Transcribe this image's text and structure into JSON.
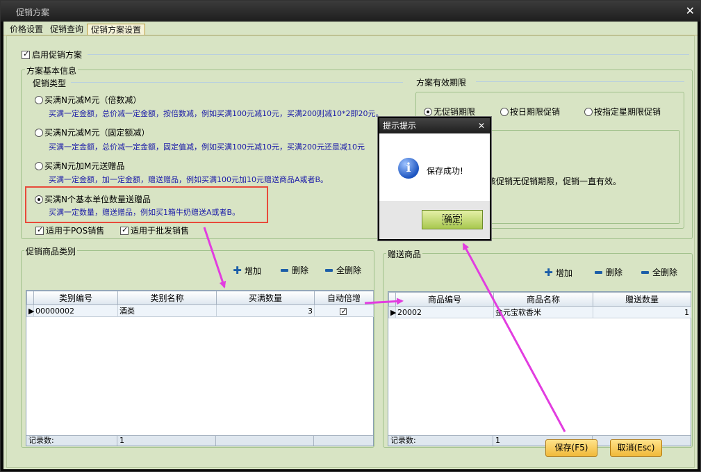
{
  "window": {
    "title": "促销方案",
    "close_glyph": "✕"
  },
  "tabs": [
    {
      "label": "价格设置"
    },
    {
      "label": "促销查询"
    },
    {
      "label": "促销方案设置"
    }
  ],
  "enable_label": "启用促销方案",
  "basic_info": {
    "title": "方案基本信息",
    "type_title": "促销类型",
    "options": [
      {
        "label": "买满N元减M元（倍数减）",
        "desc": "买满一定金额，总价减一定金额，按倍数减，例如买满100元减10元，买满200则减10*2即20元。"
      },
      {
        "label": "买满N元减M元（固定额减）",
        "desc": "买满一定金额，总价减一定金额，固定值减，例如买满100元减10元，买满200元还是减10元"
      },
      {
        "label": "买满N元加M元送赠品",
        "desc": "买满一定金额，加一定金额，赠送赠品，例如买满100元加10元赠送商品A或者B。"
      },
      {
        "label": "买满N个基本单位数量送赠品",
        "desc": "买满一定数量，赠送赠品，例如买1箱牛奶赠送A或者B。"
      }
    ],
    "pos_label": "适用于POS销售",
    "wholesale_label": "适用于批发销售"
  },
  "validity": {
    "title": "方案有效期限",
    "options": [
      {
        "label": "无促销期限"
      },
      {
        "label": "按日期限促销"
      },
      {
        "label": "按指定星期限促销"
      }
    ],
    "note": "该促销无促销期限，促销一直有效。"
  },
  "category_panel": {
    "title": "促销商品类别",
    "add_label": "增加",
    "delete_label": "删除",
    "delete_all_label": "全删除",
    "columns": [
      "类别编号",
      "类别名称",
      "买满数量",
      "自动倍增"
    ],
    "rows": [
      {
        "code": "00000002",
        "name": "酒类",
        "qty": "3",
        "auto": true
      }
    ],
    "footer_label": "记录数:",
    "footer_count": "1"
  },
  "gift_panel": {
    "title": "赠送商品",
    "add_label": "增加",
    "delete_label": "删除",
    "delete_all_label": "全删除",
    "columns": [
      "商品编号",
      "商品名称",
      "赠送数量"
    ],
    "rows": [
      {
        "code": "20002",
        "name": "金元宝软香米",
        "qty": "1"
      }
    ],
    "footer_label": "记录数:",
    "footer_count": "1"
  },
  "buttons": {
    "save": "保存(F5)",
    "cancel": "取消(Esc)"
  },
  "dialog": {
    "title": "提示提示",
    "message": "保存成功!",
    "ok": "确定",
    "close_glyph": "✕",
    "icon_glyph": "i"
  },
  "colors": {
    "accent_red": "#e84a3a",
    "annotation_magenta": "#e23de0",
    "desc_blue": "#1a1aa8",
    "panel_bg": "#d8e4c4"
  }
}
